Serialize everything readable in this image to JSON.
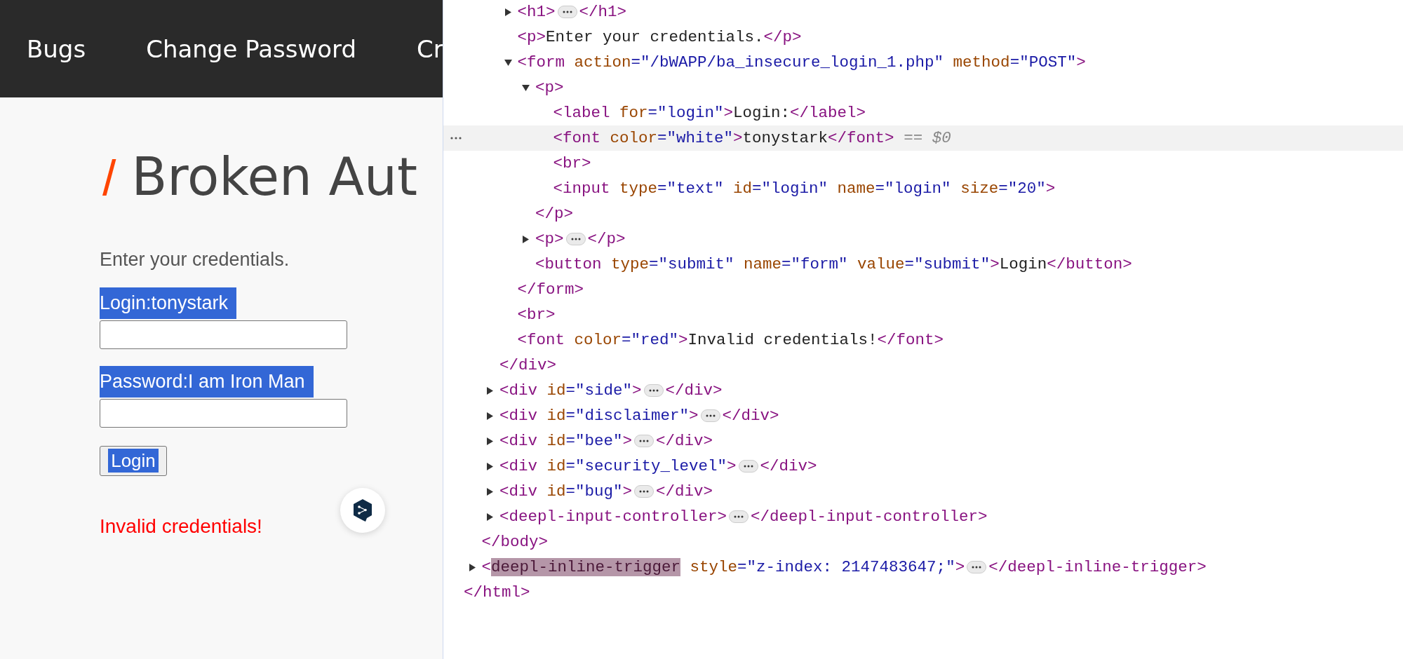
{
  "page": {
    "nav": [
      {
        "label": "Bugs"
      },
      {
        "label": "Change Password"
      },
      {
        "label": "Cr"
      }
    ],
    "heading": {
      "mark": "/",
      "text": "Broken Aut"
    },
    "intro": "Enter your credentials.",
    "fields": [
      {
        "label": "Login:tonystark",
        "highlighted": true
      },
      {
        "label": "Password:I am Iron Man",
        "highlighted": true
      }
    ],
    "button": {
      "label": "Login",
      "highlighted": true
    },
    "error": "Invalid credentials!"
  },
  "dom_tree": [
    {
      "children": [
        {
          "children": [
            {
              "children": [
                {
                  "line": [
                    {
                      "kind": "tag",
                      "text": "<h1>"
                    },
                    {
                      "kind": "more"
                    },
                    {
                      "kind": "tag",
                      "text": "</h1>"
                    }
                  ],
                  "expanded": false,
                  "selected": false
                },
                {
                  "line": [
                    {
                      "kind": "tag",
                      "text": "<p>"
                    },
                    {
                      "kind": "text",
                      "text": "Enter your credentials."
                    },
                    {
                      "kind": "tag",
                      "text": "</p>"
                    }
                  ],
                  "selected": false
                },
                {
                  "line": [
                    {
                      "kind": "tag",
                      "text": "<form"
                    },
                    {
                      "kind": "attr",
                      "text": " action"
                    },
                    {
                      "kind": "value",
                      "text": "=\"/bWAPP/ba_insecure_login_1.php\""
                    },
                    {
                      "kind": "attr",
                      "text": " method"
                    },
                    {
                      "kind": "value",
                      "text": "=\"POST\""
                    },
                    {
                      "kind": "tag",
                      "text": ">"
                    }
                  ],
                  "expanded": true,
                  "selected": false,
                  "children": [
                    {
                      "line": [
                        {
                          "kind": "tag",
                          "text": "<p>"
                        }
                      ],
                      "expanded": true,
                      "selected": false,
                      "children": [
                        {
                          "line": [
                            {
                              "kind": "tag",
                              "text": "<label"
                            },
                            {
                              "kind": "attr",
                              "text": " for"
                            },
                            {
                              "kind": "value",
                              "text": "=\"login\""
                            },
                            {
                              "kind": "tag",
                              "text": ">"
                            },
                            {
                              "kind": "text",
                              "text": "Login:"
                            },
                            {
                              "kind": "tag",
                              "text": "</label>"
                            }
                          ],
                          "selected": false
                        },
                        {
                          "line": [
                            {
                              "kind": "tag",
                              "text": "<font"
                            },
                            {
                              "kind": "attr",
                              "text": " color"
                            },
                            {
                              "kind": "value",
                              "text": "=\"white\""
                            },
                            {
                              "kind": "tag",
                              "text": ">"
                            },
                            {
                              "kind": "text",
                              "text": "tonystark"
                            },
                            {
                              "kind": "tag",
                              "text": "</font>"
                            },
                            {
                              "kind": "hint",
                              "text": " == $0"
                            }
                          ],
                          "selected": true
                        },
                        {
                          "line": [
                            {
                              "kind": "tag",
                              "text": "<br>"
                            }
                          ],
                          "selected": false
                        },
                        {
                          "line": [
                            {
                              "kind": "tag",
                              "text": "<input"
                            },
                            {
                              "kind": "attr",
                              "text": " type"
                            },
                            {
                              "kind": "value",
                              "text": "=\"text\""
                            },
                            {
                              "kind": "attr",
                              "text": " id"
                            },
                            {
                              "kind": "value",
                              "text": "=\"login\""
                            },
                            {
                              "kind": "attr",
                              "text": " name"
                            },
                            {
                              "kind": "value",
                              "text": "=\"login\""
                            },
                            {
                              "kind": "attr",
                              "text": " size"
                            },
                            {
                              "kind": "value",
                              "text": "=\"20\""
                            },
                            {
                              "kind": "tag",
                              "text": ">"
                            }
                          ],
                          "selected": false
                        }
                      ]
                    },
                    {
                      "line": [
                        {
                          "kind": "tag",
                          "text": "</p>"
                        }
                      ],
                      "selected": false
                    },
                    {
                      "line": [
                        {
                          "kind": "tag",
                          "text": "<p>"
                        },
                        {
                          "kind": "more"
                        },
                        {
                          "kind": "tag",
                          "text": "</p>"
                        }
                      ],
                      "expanded": false,
                      "selected": false
                    },
                    {
                      "line": [
                        {
                          "kind": "tag",
                          "text": "<button"
                        },
                        {
                          "kind": "attr",
                          "text": " type"
                        },
                        {
                          "kind": "value",
                          "text": "=\"submit\""
                        },
                        {
                          "kind": "attr",
                          "text": " name"
                        },
                        {
                          "kind": "value",
                          "text": "=\"form\""
                        },
                        {
                          "kind": "attr",
                          "text": " value"
                        },
                        {
                          "kind": "value",
                          "text": "=\"submit\""
                        },
                        {
                          "kind": "tag",
                          "text": ">"
                        },
                        {
                          "kind": "text",
                          "text": "Login"
                        },
                        {
                          "kind": "tag",
                          "text": "</button>"
                        }
                      ],
                      "selected": false
                    }
                  ]
                },
                {
                  "line": [
                    {
                      "kind": "tag",
                      "text": "</form>"
                    }
                  ],
                  "selected": false
                },
                {
                  "line": [
                    {
                      "kind": "tag",
                      "text": "<br>"
                    }
                  ],
                  "selected": false
                },
                {
                  "line": [
                    {
                      "kind": "tag",
                      "text": "<font"
                    },
                    {
                      "kind": "attr",
                      "text": " color"
                    },
                    {
                      "kind": "value",
                      "text": "=\"red\""
                    },
                    {
                      "kind": "tag",
                      "text": ">"
                    },
                    {
                      "kind": "text",
                      "text": "Invalid credentials!"
                    },
                    {
                      "kind": "tag",
                      "text": "</font>"
                    }
                  ],
                  "selected": false
                }
              ]
            },
            {
              "line": [
                {
                  "kind": "tag",
                  "text": "</div>"
                }
              ],
              "selected": false
            },
            {
              "line": [
                {
                  "kind": "tag",
                  "text": "<div"
                },
                {
                  "kind": "attr",
                  "text": " id"
                },
                {
                  "kind": "value",
                  "text": "=\"side\""
                },
                {
                  "kind": "tag",
                  "text": ">"
                },
                {
                  "kind": "more"
                },
                {
                  "kind": "tag",
                  "text": "</div>"
                }
              ],
              "expanded": false,
              "selected": false
            },
            {
              "line": [
                {
                  "kind": "tag",
                  "text": "<div"
                },
                {
                  "kind": "attr",
                  "text": " id"
                },
                {
                  "kind": "value",
                  "text": "=\"disclaimer\""
                },
                {
                  "kind": "tag",
                  "text": ">"
                },
                {
                  "kind": "more"
                },
                {
                  "kind": "tag",
                  "text": "</div>"
                }
              ],
              "expanded": false,
              "selected": false
            },
            {
              "line": [
                {
                  "kind": "tag",
                  "text": "<div"
                },
                {
                  "kind": "attr",
                  "text": " id"
                },
                {
                  "kind": "value",
                  "text": "=\"bee\""
                },
                {
                  "kind": "tag",
                  "text": ">"
                },
                {
                  "kind": "more"
                },
                {
                  "kind": "tag",
                  "text": "</div>"
                }
              ],
              "expanded": false,
              "selected": false
            },
            {
              "line": [
                {
                  "kind": "tag",
                  "text": "<div"
                },
                {
                  "kind": "attr",
                  "text": " id"
                },
                {
                  "kind": "value",
                  "text": "=\"security_level\""
                },
                {
                  "kind": "tag",
                  "text": ">"
                },
                {
                  "kind": "more"
                },
                {
                  "kind": "tag",
                  "text": "</div>"
                }
              ],
              "expanded": false,
              "selected": false
            },
            {
              "line": [
                {
                  "kind": "tag",
                  "text": "<div"
                },
                {
                  "kind": "attr",
                  "text": " id"
                },
                {
                  "kind": "value",
                  "text": "=\"bug\""
                },
                {
                  "kind": "tag",
                  "text": ">"
                },
                {
                  "kind": "more"
                },
                {
                  "kind": "tag",
                  "text": "</div>"
                }
              ],
              "expanded": false,
              "selected": false
            },
            {
              "line": [
                {
                  "kind": "tag",
                  "text": "<deepl-input-controller>"
                },
                {
                  "kind": "more"
                },
                {
                  "kind": "tag",
                  "text": "</deepl-input-controller>"
                }
              ],
              "expanded": false,
              "selected": false
            }
          ]
        },
        {
          "line": [
            {
              "kind": "tag",
              "text": "</body>"
            }
          ],
          "selected": false
        },
        {
          "line": [
            {
              "kind": "tag",
              "text": "<"
            },
            {
              "kind": "match",
              "text": "deepl-inline-trigger"
            },
            {
              "kind": "attr",
              "text": " style"
            },
            {
              "kind": "value",
              "text": "=\"z-index: 2147483647;\""
            },
            {
              "kind": "tag",
              "text": ">"
            },
            {
              "kind": "more"
            },
            {
              "kind": "tag",
              "text": "</deepl-inline-trigger>"
            }
          ],
          "expanded": false,
          "selected": false
        }
      ]
    },
    {
      "line": [
        {
          "kind": "tag",
          "text": "</html>"
        }
      ],
      "selected": false
    }
  ]
}
